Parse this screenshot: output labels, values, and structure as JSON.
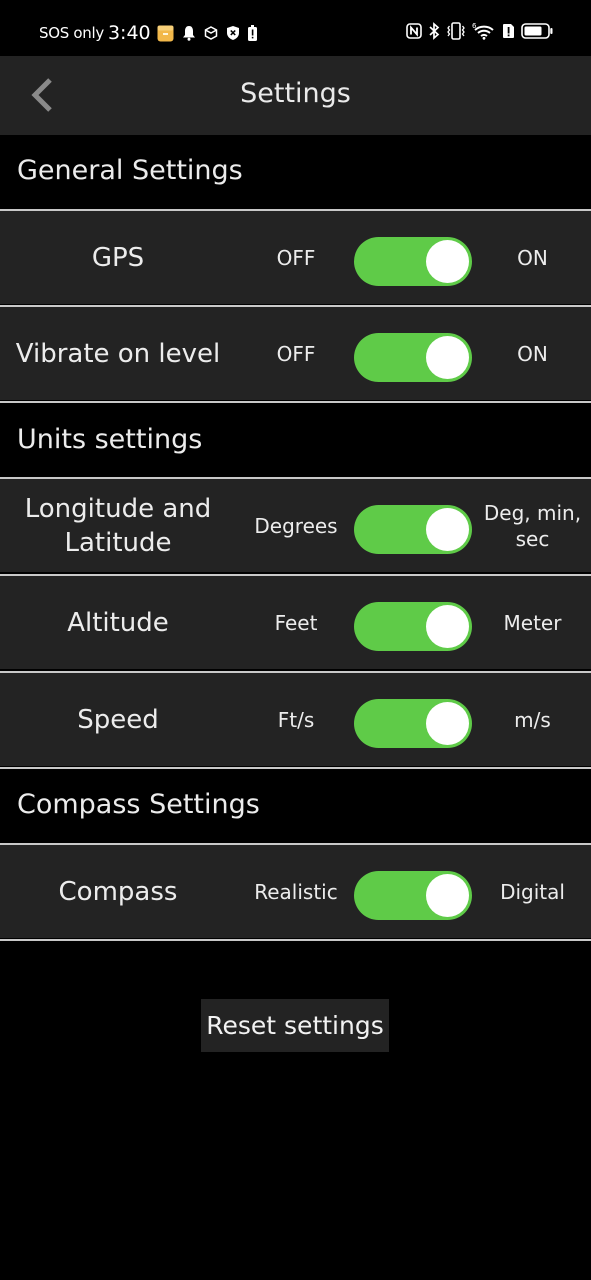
{
  "status_bar": {
    "carrier": "SOS only",
    "time": "3:40",
    "left_icons": [
      "notes-app-icon",
      "bell-icon",
      "box-icon",
      "shield-x-icon",
      "battery-alert-icon"
    ],
    "right_icons": [
      "nfc-icon",
      "bluetooth-icon",
      "vibrate-icon",
      "wifi-6-icon",
      "sim-alert-icon",
      "battery-icon"
    ],
    "wifi_badge": "6"
  },
  "app_bar": {
    "title": "Settings",
    "back_icon": "chevron-left-icon"
  },
  "colors": {
    "toggle_on": "#5fcb48",
    "row_background": "#232323",
    "page_background": "#000000",
    "divider": "#c8c8c8"
  },
  "sections": [
    {
      "title": "General Settings",
      "rows": [
        {
          "label": "GPS",
          "left_option": "OFF",
          "right_option": "ON",
          "enabled": true
        },
        {
          "label": "Vibrate on level",
          "left_option": "OFF",
          "right_option": "ON",
          "enabled": true
        }
      ]
    },
    {
      "title": "Units settings",
      "rows": [
        {
          "label": "Longitude and Latitude",
          "left_option": "Degrees",
          "right_option": "Deg, min, sec",
          "enabled": true
        },
        {
          "label": "Altitude",
          "left_option": "Feet",
          "right_option": "Meter",
          "enabled": true
        },
        {
          "label": "Speed",
          "left_option": "Ft/s",
          "right_option": "m/s",
          "enabled": true
        }
      ]
    },
    {
      "title": "Compass Settings",
      "rows": [
        {
          "label": "Compass",
          "left_option": "Realistic",
          "right_option": "Digital",
          "enabled": true
        }
      ]
    }
  ],
  "reset_button": {
    "label": "Reset settings"
  }
}
